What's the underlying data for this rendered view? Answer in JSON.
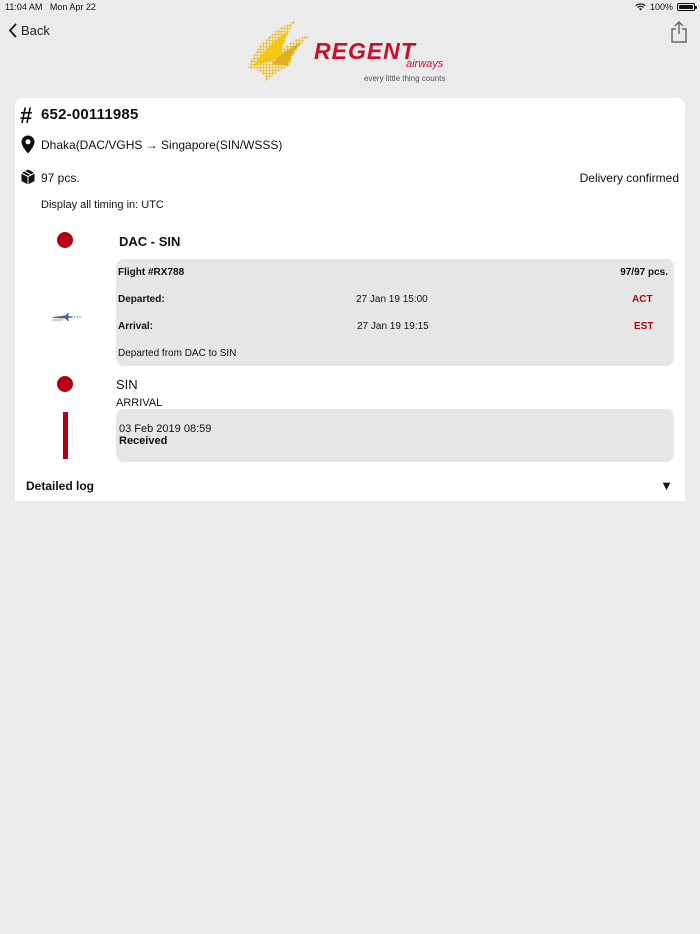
{
  "status_bar": {
    "time": "11:04 AM",
    "date": "Mon Apr 22",
    "battery": "100%",
    "wifi_icon": "wifi-icon",
    "battery_icon": "battery-icon"
  },
  "nav": {
    "back_label": "Back",
    "back_icon": "chevron-left-icon",
    "share_icon": "share-icon"
  },
  "logo": {
    "brand": "REGENT",
    "sub": "airways",
    "tagline": "every little thing counts",
    "colors": {
      "red": "#c8102e",
      "gold": "#f2c200"
    }
  },
  "shipment": {
    "awb": "652-00111985",
    "route": "Dhaka(DAC/VGHS → Singapore(SIN/WSSS)",
    "pieces": "97 pcs.",
    "delivery_status": "Delivery confirmed",
    "timing_note": "Display all timing in: UTC"
  },
  "segment": {
    "title": "DAC - SIN",
    "flight": "Flight #RX788",
    "flight_pieces": "97/97 pcs.",
    "departed_label": "Departed:",
    "departed_time": "27 Jan 19 15:00",
    "departed_status": "ACT",
    "arrival_label": "Arrival:",
    "arrival_time": "27 Jan 19 19:15",
    "arrival_status": "EST",
    "note": "Departed from DAC to SIN"
  },
  "destination": {
    "code": "SIN",
    "type": "ARRIVAL",
    "event_date": "03 Feb 2019 08:59",
    "event_status": "Received"
  },
  "log": {
    "label": "Detailed log",
    "arrow": "▼"
  },
  "colors": {
    "accent": "#b30016",
    "background": "#ebebeb",
    "card": "#ffffff",
    "panel": "#e6e6e6"
  }
}
